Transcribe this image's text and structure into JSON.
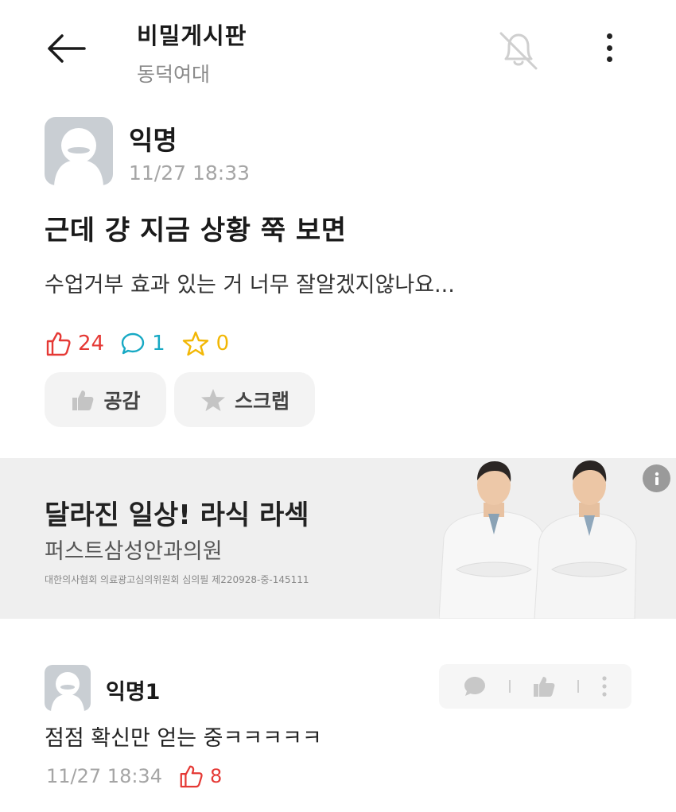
{
  "header": {
    "title": "비밀게시판",
    "subtitle": "동덕여대",
    "icons": {
      "back": "arrow-left-icon",
      "notification": "bell-off-icon",
      "more": "more-vertical-icon"
    }
  },
  "post": {
    "author": "익명",
    "time": "11/27 18:33",
    "title": "근데 걍 지금 상황 쭉 보면",
    "body": "수업거부 효과 있는 거 너무 잘알겠지않나요...",
    "stats": {
      "likes": "24",
      "comments": "1",
      "scraps": "0"
    },
    "buttons": {
      "like": "공감",
      "scrap": "스크랩"
    }
  },
  "ad": {
    "headline": "달라진 일상! 라식 라섹",
    "clinic": "퍼스트삼성안과의원",
    "disclaimer": "대한의사협회 의료광고심의위원회 심의필 제220928-중-145111"
  },
  "comments": [
    {
      "author": "익명1",
      "text": "점점 확신만 얻는 중ㅋㅋㅋㅋㅋ",
      "time": "11/27 18:34",
      "likes": "8"
    }
  ],
  "colors": {
    "like": "#e53935",
    "comment": "#17a9c4",
    "scrap": "#f2b705",
    "muted": "#a5a5a5",
    "button_bg": "#f3f3f3",
    "ad_bg": "#efefef"
  }
}
